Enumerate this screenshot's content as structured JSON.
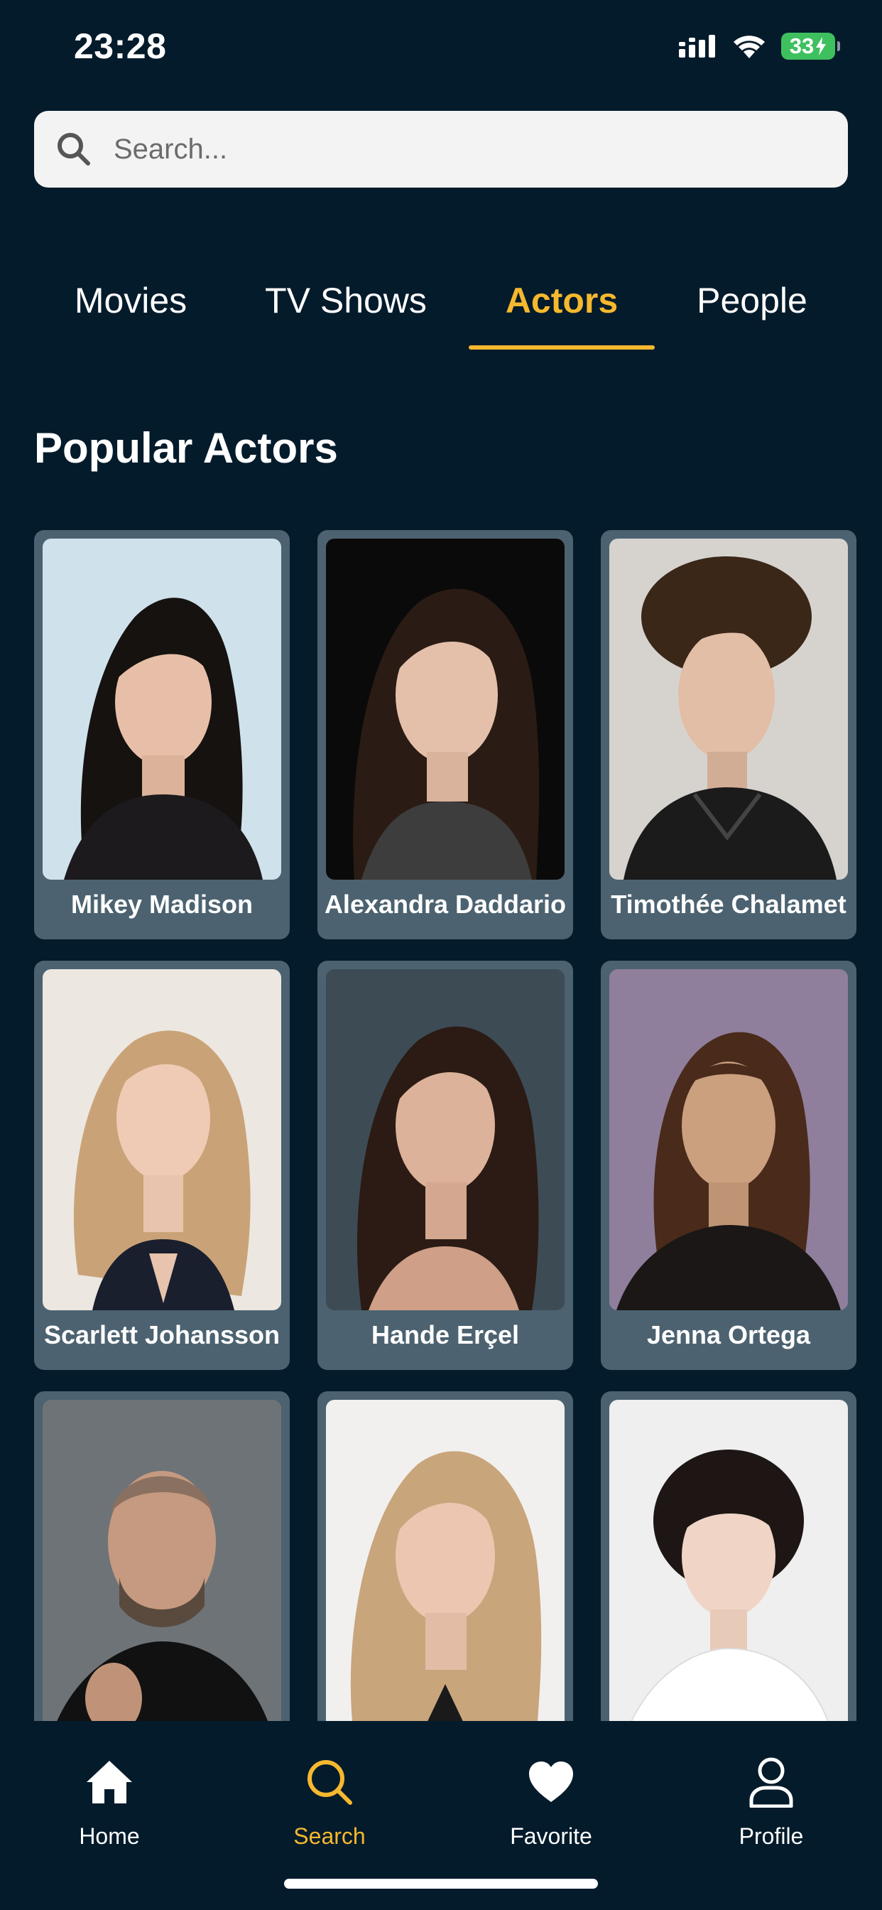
{
  "status_bar": {
    "time": "23:28",
    "battery": "33",
    "icons": [
      "signal-icon",
      "wifi-icon",
      "battery-charging-icon"
    ]
  },
  "search": {
    "placeholder": "Search...",
    "value": "",
    "icon": "search-icon"
  },
  "tabs": [
    {
      "label": "Movies",
      "active": false
    },
    {
      "label": "TV Shows",
      "active": false
    },
    {
      "label": "Actors",
      "active": true
    },
    {
      "label": "People",
      "active": false
    }
  ],
  "section": {
    "title": "Popular Actors"
  },
  "actors": [
    {
      "name": "Mikey Madison"
    },
    {
      "name": "Alexandra Daddario"
    },
    {
      "name": "Timothée Chalamet"
    },
    {
      "name": "Scarlett Johansson"
    },
    {
      "name": "Hande Erçel"
    },
    {
      "name": "Jenna Ortega"
    },
    {
      "name": ""
    },
    {
      "name": ""
    },
    {
      "name": ""
    }
  ],
  "bottom_nav": [
    {
      "label": "Home",
      "icon": "home-icon",
      "active": false
    },
    {
      "label": "Search",
      "icon": "search-icon",
      "active": true
    },
    {
      "label": "Favorite",
      "icon": "heart-icon",
      "active": false
    },
    {
      "label": "Profile",
      "icon": "user-icon",
      "active": false
    }
  ],
  "colors": {
    "background": "#031b2b",
    "accent": "#f5b82e",
    "card": "#4c6270",
    "search_bg": "#f3f3f3",
    "battery": "#3ec05f"
  }
}
